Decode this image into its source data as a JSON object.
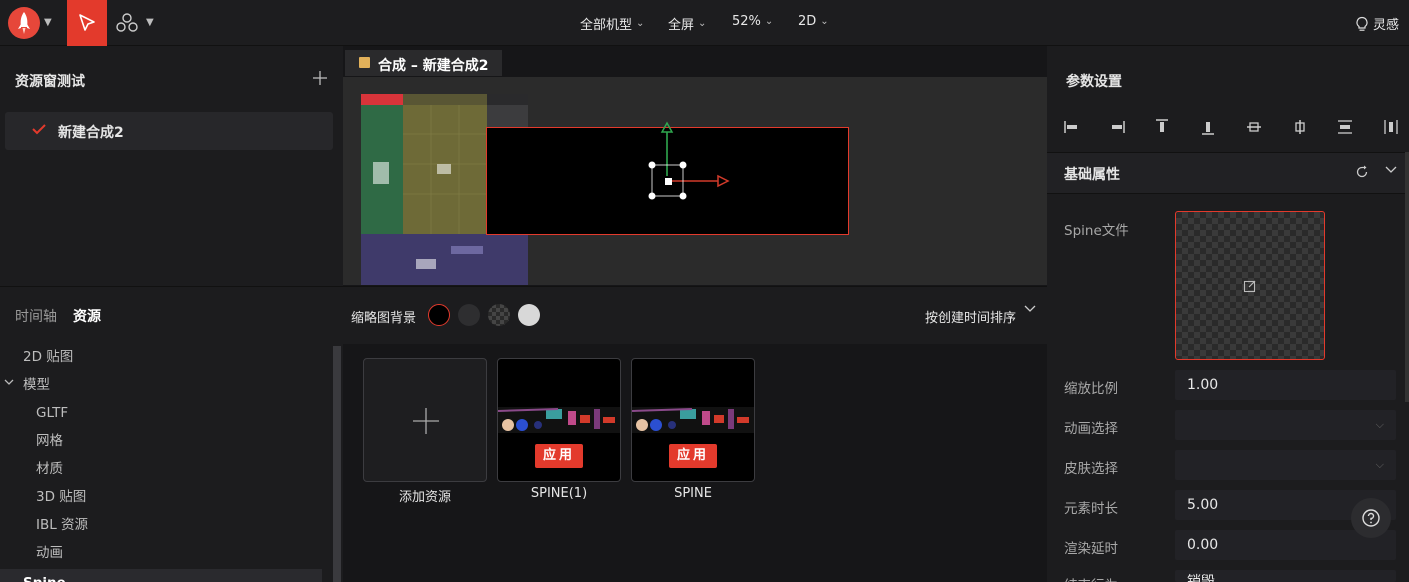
{
  "topbar": {
    "menus": [
      {
        "label": "全部机型"
      },
      {
        "label": "全屏"
      },
      {
        "label": "52%"
      },
      {
        "label": "2D"
      }
    ],
    "inspiration_label": "灵感"
  },
  "assets_window": {
    "title": "资源窗测试",
    "composition_item": "新建合成2"
  },
  "left_tabs": {
    "timeline": "时间轴",
    "assets": "资源"
  },
  "tree": [
    {
      "label": "2D 贴图"
    },
    {
      "label": "模型"
    },
    {
      "label": "GLTF"
    },
    {
      "label": "网格"
    },
    {
      "label": "材质"
    },
    {
      "label": "3D 贴图"
    },
    {
      "label": "IBL 资源"
    },
    {
      "label": "动画"
    },
    {
      "label": "Spine"
    }
  ],
  "doc_tab": {
    "label": "合成 – 新建合成2",
    "color": "#e2b15a"
  },
  "thumb_bar": {
    "bg_label": "缩略图背景",
    "sort_label": "按创建时间排序",
    "swatches": [
      "#000000",
      "#2e2e30",
      "checker",
      "#d8d8d8"
    ]
  },
  "asset_cards": {
    "add_label": "添加资源",
    "apply_label": "应用",
    "items": [
      {
        "label": "SPINE(1)"
      },
      {
        "label": "SPINE"
      }
    ]
  },
  "params": {
    "title": "参数设置",
    "section_title": "基础属性",
    "spine_file_label": "Spine文件",
    "scale_label": "缩放比例",
    "scale_value": "1.00",
    "anim_label": "动画选择",
    "skin_label": "皮肤选择",
    "duration_label": "元素时长",
    "duration_value": "5.00",
    "delay_label": "渲染延时",
    "delay_value": "0.00",
    "end_label": "结束行为",
    "end_value": "销毁"
  },
  "colors": {
    "accent": "#e33a2c",
    "gizmo_y": "#2fa84f",
    "gizmo_x": "#d23a2a"
  }
}
